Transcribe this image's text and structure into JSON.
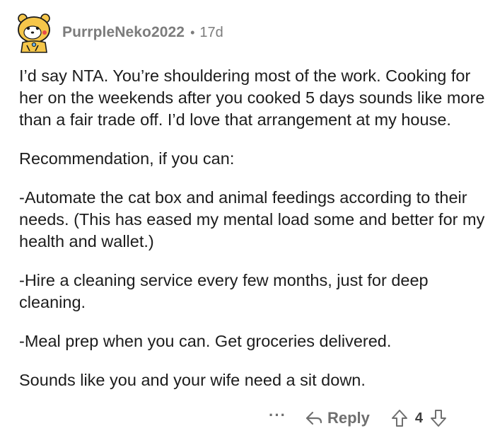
{
  "comment": {
    "author": "PurrpleNeko2022",
    "separator": "•",
    "age": "17d",
    "paragraphs": [
      "I’d say NTA. You’re shouldering most of the work. Cooking for her on the weekends after you cooked 5 days sounds like more than a fair trade off. I’d love that arrangement at my house.",
      "Recommendation, if you can:",
      "-Automate the cat box and animal feedings according to their needs. (This has eased my mental load some and better for my health and wallet.)",
      "-Hire a cleaning service every few months, just for deep cleaning.",
      "-Meal prep when you can. Get groceries delivered.",
      "Sounds like you and your wife need a sit down."
    ]
  },
  "actions": {
    "more_label": "···",
    "reply_label": "Reply",
    "score": "4"
  },
  "icons": {
    "avatar": "snoo-avatar-icon",
    "reply": "reply-arrow-icon",
    "upvote": "upvote-arrow-icon",
    "downvote": "downvote-arrow-icon"
  },
  "colors": {
    "meta_text": "#7c7c7c",
    "body_text": "#1c1c1c",
    "action_text": "#6f6f6f",
    "avatar_yellow": "#f5c64a"
  }
}
